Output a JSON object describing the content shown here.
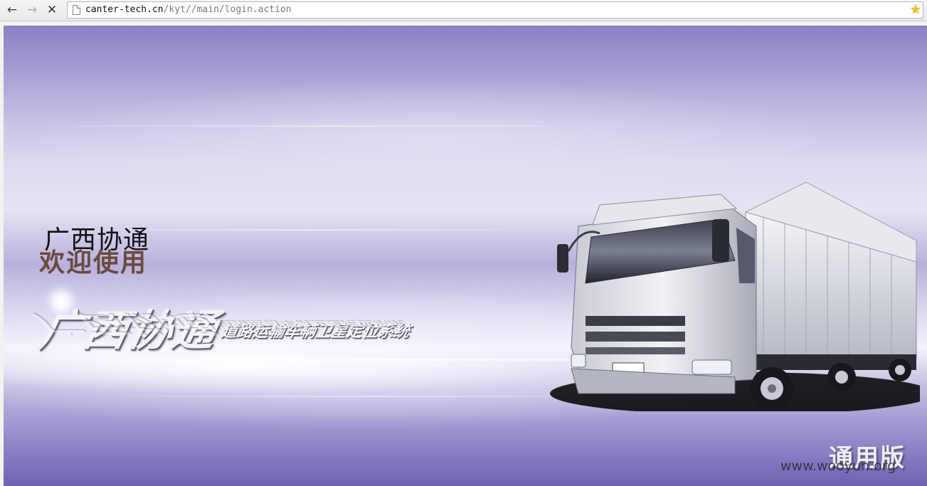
{
  "browser": {
    "back_icon": "arrow-left-icon",
    "forward_icon": "arrow-right-icon",
    "stop_icon": "close-icon",
    "page_icon": "document-icon",
    "bookmark_icon": "star-icon",
    "url_host": "canter-tech.cn",
    "url_path": "/kyt//main/login.action"
  },
  "page": {
    "company_name": "广西协通",
    "welcome": "欢迎使用",
    "logo": {
      "title": "广西协通",
      "subtitle": "道路运输车辆卫星定位系统"
    },
    "version_stamp": "通用版",
    "watermark": "www.wooyun.org"
  },
  "colors": {
    "background_top": "#8a80c4",
    "background_bottom": "#6d62b2",
    "welcome_text": "#6b4a3e",
    "bookmark_star": "#f0c030"
  }
}
